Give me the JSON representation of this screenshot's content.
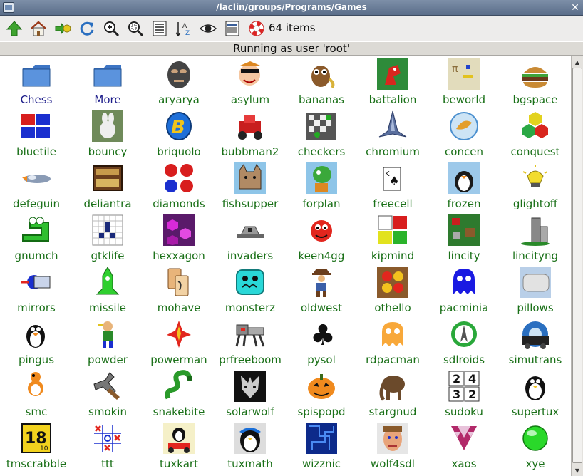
{
  "window": {
    "title": "/laclin/groups/Programs/Games",
    "close_glyph": "✕"
  },
  "toolbar": {
    "buttons": [
      {
        "icon": "up-arrow-icon"
      },
      {
        "icon": "home-icon"
      },
      {
        "icon": "go-back-icon"
      },
      {
        "icon": "refresh-icon"
      },
      {
        "icon": "zoom-in-icon"
      },
      {
        "icon": "zoom-fit-icon"
      },
      {
        "icon": "details-view-icon"
      },
      {
        "icon": "sort-az-icon"
      },
      {
        "icon": "show-hidden-eye-icon"
      },
      {
        "icon": "list-view-icon"
      },
      {
        "icon": "help-lifebuoy-icon"
      }
    ],
    "item_count": "64 items"
  },
  "status": {
    "text": "Running as user 'root'"
  },
  "items": [
    {
      "label": "Chess",
      "kind": "folder"
    },
    {
      "label": "More",
      "kind": "folder"
    },
    {
      "label": "aryarya",
      "kind": "app"
    },
    {
      "label": "asylum",
      "kind": "app"
    },
    {
      "label": "bananas",
      "kind": "app"
    },
    {
      "label": "battalion",
      "kind": "app"
    },
    {
      "label": "beworld",
      "kind": "app"
    },
    {
      "label": "bgspace",
      "kind": "app"
    },
    {
      "label": "bluetile",
      "kind": "app"
    },
    {
      "label": "bouncy",
      "kind": "app"
    },
    {
      "label": "briquolo",
      "kind": "app"
    },
    {
      "label": "bubbman2",
      "kind": "app"
    },
    {
      "label": "checkers",
      "kind": "app"
    },
    {
      "label": "chromium",
      "kind": "app"
    },
    {
      "label": "concen",
      "kind": "app"
    },
    {
      "label": "conquest",
      "kind": "app"
    },
    {
      "label": "defeguin",
      "kind": "app"
    },
    {
      "label": "deliantra",
      "kind": "app"
    },
    {
      "label": "diamonds",
      "kind": "app"
    },
    {
      "label": "fishsupper",
      "kind": "app"
    },
    {
      "label": "forplan",
      "kind": "app"
    },
    {
      "label": "freecell",
      "kind": "app"
    },
    {
      "label": "frozen",
      "kind": "app"
    },
    {
      "label": "glightoff",
      "kind": "app"
    },
    {
      "label": "gnumch",
      "kind": "app"
    },
    {
      "label": "gtklife",
      "kind": "app"
    },
    {
      "label": "hexxagon",
      "kind": "app"
    },
    {
      "label": "invaders",
      "kind": "app"
    },
    {
      "label": "keen4gg",
      "kind": "app"
    },
    {
      "label": "kipmind",
      "kind": "app"
    },
    {
      "label": "lincity",
      "kind": "app"
    },
    {
      "label": "lincityng",
      "kind": "app"
    },
    {
      "label": "mirrors",
      "kind": "app"
    },
    {
      "label": "missile",
      "kind": "app"
    },
    {
      "label": "mohave",
      "kind": "app"
    },
    {
      "label": "monsterz",
      "kind": "app"
    },
    {
      "label": "oldwest",
      "kind": "app"
    },
    {
      "label": "othello",
      "kind": "app"
    },
    {
      "label": "pacminia",
      "kind": "app"
    },
    {
      "label": "pillows",
      "kind": "app"
    },
    {
      "label": "pingus",
      "kind": "app"
    },
    {
      "label": "powder",
      "kind": "app"
    },
    {
      "label": "powerman",
      "kind": "app"
    },
    {
      "label": "prfreeboom",
      "kind": "app"
    },
    {
      "label": "pysol",
      "kind": "app"
    },
    {
      "label": "rdpacman",
      "kind": "app"
    },
    {
      "label": "sdlroids",
      "kind": "app"
    },
    {
      "label": "simutrans",
      "kind": "app"
    },
    {
      "label": "smc",
      "kind": "app"
    },
    {
      "label": "smokin",
      "kind": "app"
    },
    {
      "label": "snakebite",
      "kind": "app"
    },
    {
      "label": "solarwolf",
      "kind": "app"
    },
    {
      "label": "spispopd",
      "kind": "app"
    },
    {
      "label": "stargnud",
      "kind": "app"
    },
    {
      "label": "sudoku",
      "kind": "app"
    },
    {
      "label": "supertux",
      "kind": "app"
    },
    {
      "label": "tmscrabble",
      "kind": "app"
    },
    {
      "label": "ttt",
      "kind": "app"
    },
    {
      "label": "tuxkart",
      "kind": "app"
    },
    {
      "label": "tuxmath",
      "kind": "app"
    },
    {
      "label": "wizznic",
      "kind": "app"
    },
    {
      "label": "wolf4sdl",
      "kind": "app"
    },
    {
      "label": "xaos",
      "kind": "app"
    },
    {
      "label": "xye",
      "kind": "app"
    }
  ],
  "colors": {
    "app_label": "#1a7018",
    "folder_label": "#1c1c8a",
    "titlebar": "#6a7d98"
  }
}
